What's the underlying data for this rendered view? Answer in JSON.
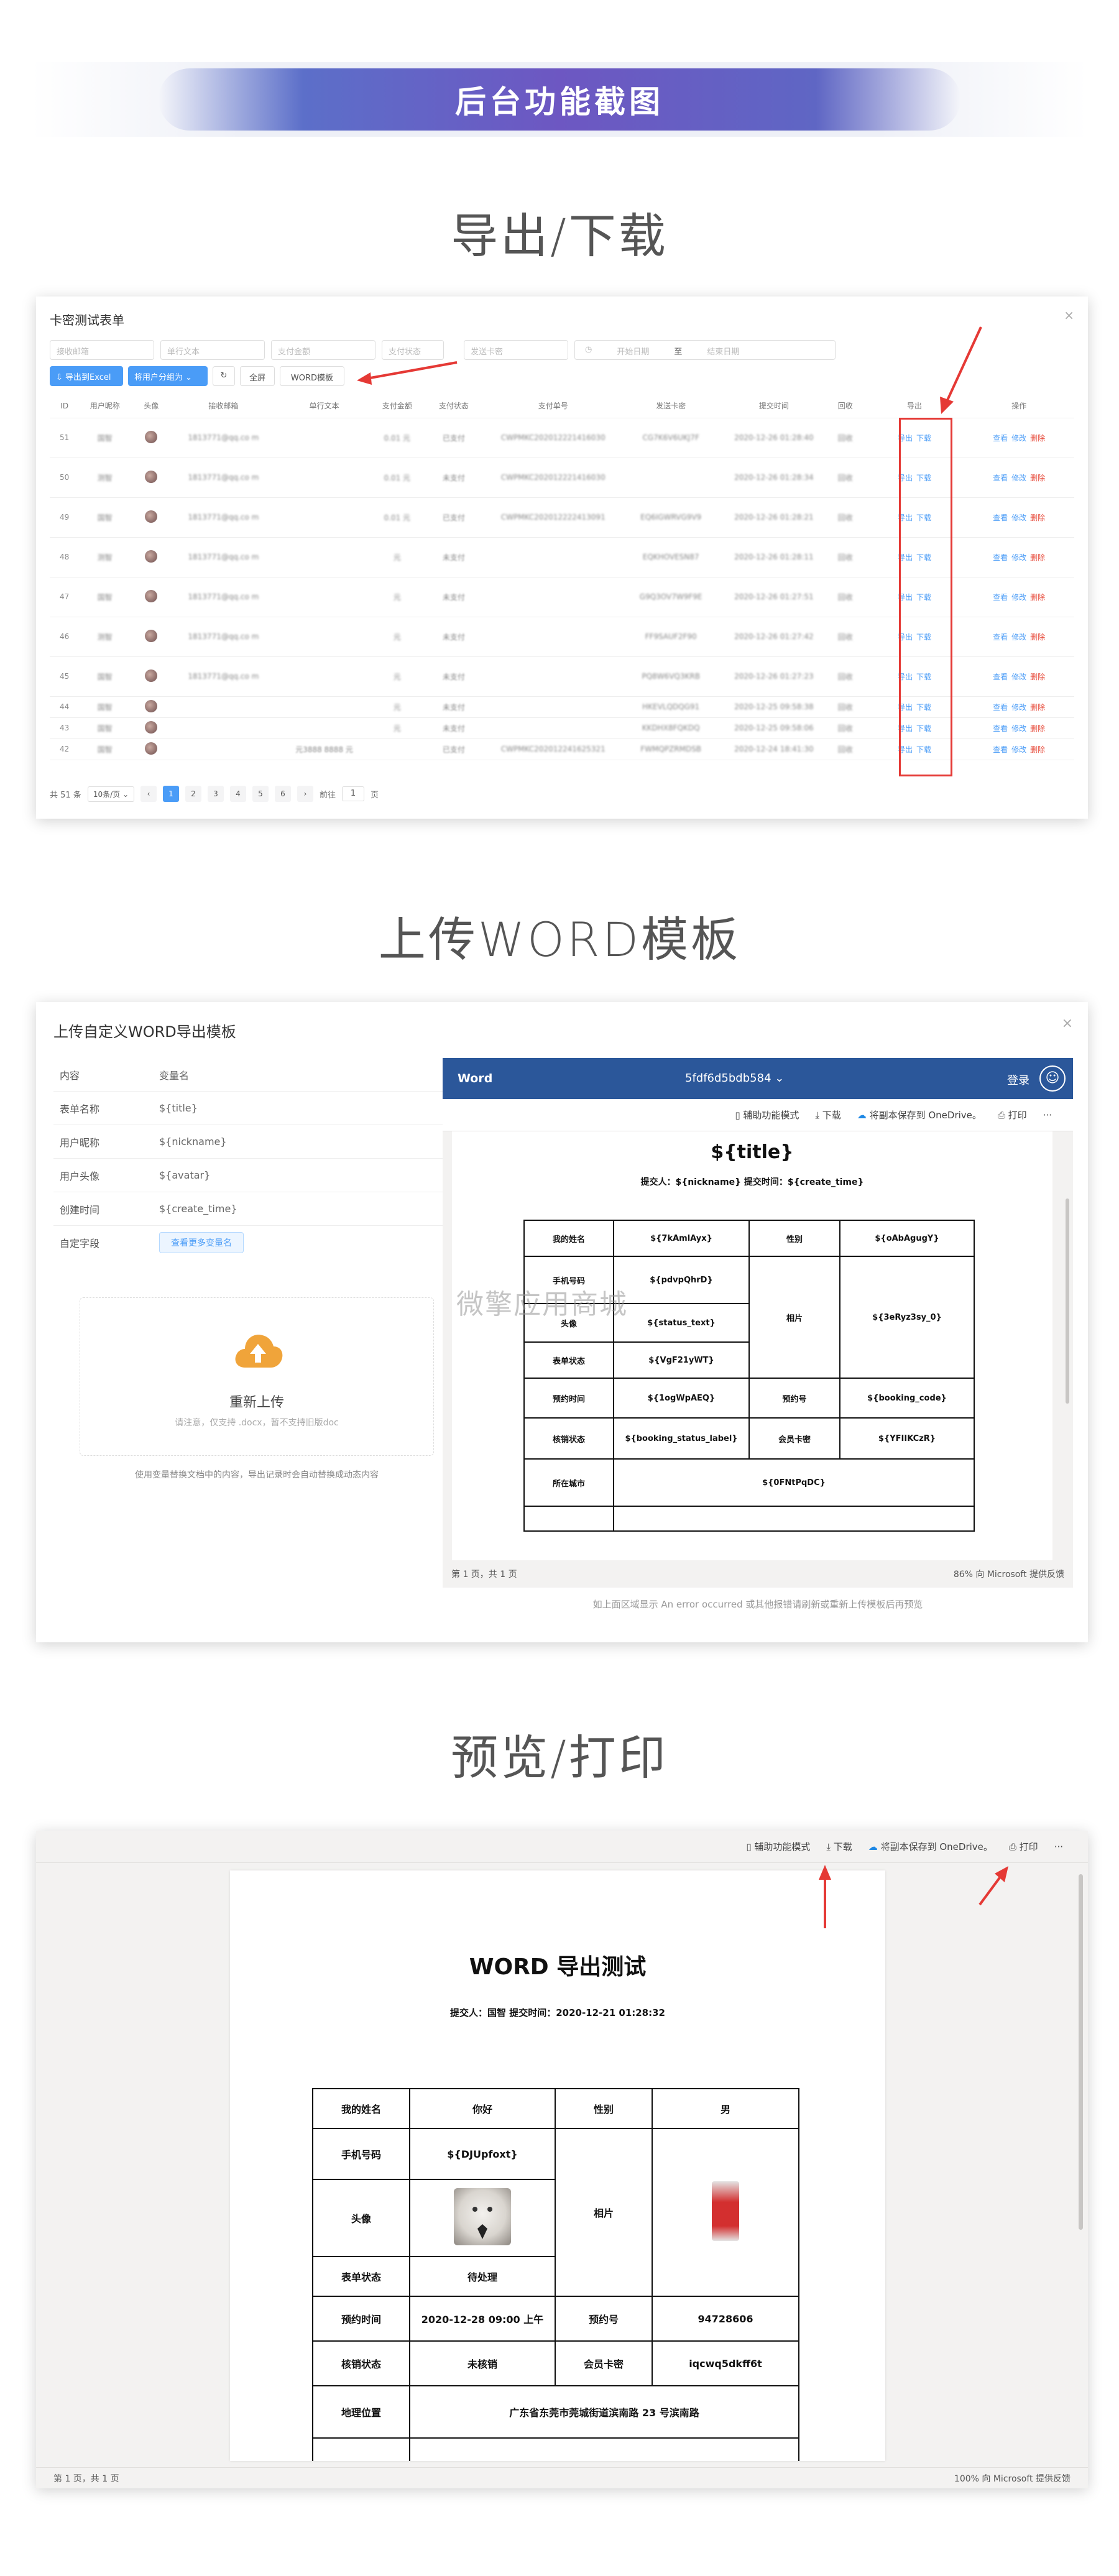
{
  "banner": {
    "title": "后台功能截图"
  },
  "sections": {
    "export": "导出/下载",
    "upload": "上传WORD模板",
    "preview": "预览/打印"
  },
  "table_view": {
    "title": "卡密测试表单",
    "close": "×",
    "filters": {
      "email": "接收邮箱",
      "text": "单行文本",
      "amount": "支付金额",
      "status": "支付状态",
      "card": "发送卡密",
      "start": "开始日期",
      "to": "至",
      "end": "结束日期"
    },
    "buttons": {
      "export_excel": "⇩ 导出到Excel",
      "assign": "将用户分组为 ⌄",
      "refresh": "↻",
      "select_all": "全屏",
      "word_tpl": "WORD模板"
    },
    "columns": [
      "ID",
      "用户昵称",
      "头像",
      "接收邮箱",
      "单行文本",
      "支付金额",
      "支付状态",
      "支付单号",
      "发送卡密",
      "提交时间",
      "回收",
      "导出",
      "操作"
    ],
    "rows": [
      {
        "id": "51",
        "nick": "国智",
        "email": "1813771@qq.co m",
        "text": "",
        "amount": "0.01 元",
        "status": "已支付",
        "status_type": "paid",
        "order": "CWPMKC202012221416030",
        "card": "CG7K6V6UKJ7F",
        "time": "2020-12-26 01:28:40",
        "recycle": "回收"
      },
      {
        "id": "50",
        "nick": "测智",
        "email": "1813771@qq.co m",
        "text": "",
        "amount": "0.01 元",
        "status": "未支付",
        "status_type": "unpaid",
        "order": "CWPMKC202012221416030",
        "card": "",
        "time": "2020-12-26 01:28:34",
        "recycle": "回收"
      },
      {
        "id": "49",
        "nick": "国智",
        "email": "1813771@qq.co m",
        "text": "",
        "amount": "0.01 元",
        "status": "已支付",
        "status_type": "paid",
        "order": "CWPMKC202012222413091",
        "card": "EQ6IGWRVG9V9",
        "time": "2020-12-26 01:28:21",
        "recycle": "回收"
      },
      {
        "id": "48",
        "nick": "测智",
        "email": "1813771@qq.co m",
        "text": "",
        "amount": "元",
        "status": "未支付",
        "status_type": "unpaid",
        "order": "",
        "card": "EQKHOVESN87",
        "time": "2020-12-26 01:28:11",
        "recycle": "回收"
      },
      {
        "id": "47",
        "nick": "国智",
        "email": "1813771@qq.co m",
        "text": "",
        "amount": "元",
        "status": "未支付",
        "status_type": "unpaid",
        "order": "",
        "card": "G9Q3OV7W9F9E",
        "time": "2020-12-26 01:27:51",
        "recycle": "回收"
      },
      {
        "id": "46",
        "nick": "测智",
        "email": "1813771@qq.co m",
        "text": "",
        "amount": "元",
        "status": "未支付",
        "status_type": "unpaid",
        "order": "",
        "card": "FF9SAUF2F90",
        "time": "2020-12-26 01:27:42",
        "recycle": "回收"
      },
      {
        "id": "45",
        "nick": "国智",
        "email": "1813771@qq.co m",
        "text": "",
        "amount": "元",
        "status": "未支付",
        "status_type": "unpaid",
        "order": "",
        "card": "PQ8W6VQ3KRB",
        "time": "2020-12-26 01:27:23",
        "recycle": "回收"
      },
      {
        "id": "44",
        "nick": "国智",
        "email": "",
        "text": "",
        "amount": "元",
        "status": "未支付",
        "status_type": "unpaid",
        "order": "",
        "card": "HKEVLQDQG91",
        "time": "2020-12-25 09:58:38",
        "recycle": "回收"
      },
      {
        "id": "43",
        "nick": "国智",
        "email": "",
        "text": "",
        "amount": "元",
        "status": "未支付",
        "status_type": "unpaid",
        "order": "",
        "card": "KKDHX8FQKDQ",
        "time": "2020-12-25 09:58:06",
        "recycle": "回收"
      },
      {
        "id": "42",
        "nick": "国智",
        "email": "",
        "text": "元3888 8888 元",
        "amount": "",
        "status": "已支付",
        "status_type": "paid",
        "order": "CWPMKC202012241625321",
        "card": "FWMQPZRMDSB",
        "time": "2020-12-24 18:41:30",
        "recycle": "回收"
      }
    ],
    "actions": {
      "export": "导出",
      "download": "下载",
      "view": "查看",
      "edit": "修改",
      "delete": "删除"
    },
    "pager": {
      "total": "共 51 条",
      "size": "10条/页 ⌄",
      "prev": "‹",
      "pages": [
        "1",
        "2",
        "3",
        "4",
        "5",
        "6"
      ],
      "current_page": 1,
      "next": "›",
      "goto": "前往",
      "goto_value": "1",
      "page_unit": "页"
    }
  },
  "upload_view": {
    "title": "上传自定义WORD导出模板",
    "close": "×",
    "header": {
      "k": "内容",
      "v": "变量名"
    },
    "vars": [
      {
        "k": "表单名称",
        "v": "${title}"
      },
      {
        "k": "用户昵称",
        "v": "${nickname}"
      },
      {
        "k": "用户头像",
        "v": "${avatar}"
      },
      {
        "k": "创建时间",
        "v": "${create_time}"
      }
    ],
    "custom_field": "自定字段",
    "more_vars": "查看更多变量名",
    "reupload": "重新上传",
    "upload_hint": "请注意，仅支持 .docx，暂不支持旧版doc",
    "tip": "使用变量替换文档中的内容，导出记录时会自动替换成动态内容",
    "word": {
      "brand": "Word",
      "doc_name": "5fdf6d5bdb584 ⌄",
      "login": "登录",
      "tools": [
        "辅助功能模式",
        "下载",
        "将副本保存到 OneDrive。",
        "打印",
        "···"
      ],
      "doc_title": "${title}",
      "doc_sub": "提交人：${nickname}    提交时间：${create_time}",
      "table": {
        "r1": [
          "我的姓名",
          "${7kAmlAyx}",
          "性别",
          "${oAbAgugY}"
        ],
        "r2": [
          "手机号码",
          "${pdvpQhrD}",
          "相片",
          "${3eRyz3sy_0}"
        ],
        "r3": [
          "头像",
          "${status_text}"
        ],
        "r4": [
          "表单状态",
          "${VgF21yWT}"
        ],
        "r5": [
          "预约时间",
          "${1ogWpAEQ}",
          "预约号",
          "${booking_code}"
        ],
        "r6": [
          "核销状态",
          "${booking_status_label}",
          "会员卡密",
          "${YFIIKCzR}"
        ],
        "r7": [
          "所在城市",
          "${0FNtPqDC}"
        ]
      },
      "status_left": "第 1 页，共 1 页",
      "status_right": "86%    向 Microsoft 提供反馈"
    },
    "hint": "如上面区域显示 An error occurred 或其他报错请刷新或重新上传模板后再预览",
    "watermark": "微擎应用商城"
  },
  "preview_view": {
    "tools": [
      "辅助功能模式",
      "下载",
      "将副本保存到 OneDrive。",
      "打印",
      "···"
    ],
    "doc_title": "WORD 导出测试",
    "doc_sub": "提交人：国智    提交时间：2020-12-21  01:28:32",
    "table": {
      "r1": [
        "我的姓名",
        "你好",
        "性别",
        "男"
      ],
      "r2": [
        "手机号码",
        "${DJUpfoxt}",
        "相片"
      ],
      "r3": [
        "头像"
      ],
      "r4": [
        "表单状态",
        "待处理"
      ],
      "r5": [
        "预约时间",
        "2020-12-28  09:00  上午",
        "预约号",
        "94728606"
      ],
      "r6": [
        "核销状态",
        "未核销",
        "会员卡密",
        "iqcwq5dkff6t"
      ],
      "r7": [
        "地理位置",
        "广东省东莞市莞城街道滨南路 23 号滨南路"
      ]
    },
    "status_left": "第 1 页，共 1 页",
    "status_right": "100%    向 Microsoft 提供反馈"
  }
}
